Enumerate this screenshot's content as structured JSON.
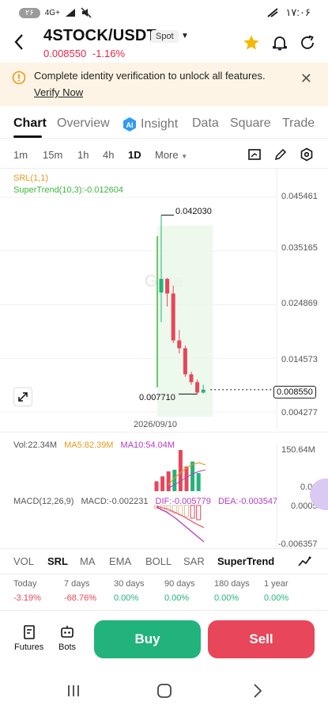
{
  "status": {
    "sim_badge": "۲۶",
    "net": "4G+",
    "time": "۱۷:۰۶"
  },
  "header": {
    "pair": "4STOCK/USDT",
    "market_type": "Spot",
    "price": "0.008550",
    "change": "-1.16%"
  },
  "banner": {
    "message": "Complete identity verification to unlock all features.",
    "link": "Verify Now"
  },
  "tabs": [
    "Chart",
    "Overview",
    "Insight",
    "Data",
    "Square",
    "Trade"
  ],
  "intervals": [
    "1m",
    "15m",
    "1h",
    "4h",
    "1D",
    "More"
  ],
  "chart": {
    "srl_label": "SRL(1,1)",
    "supertrend_label": "SuperTrend(10,3):-0.012604",
    "y_ticks": [
      "0.045461",
      "0.035165",
      "0.024869",
      "0.014573",
      "0.004277"
    ],
    "max_label": "0.042030",
    "min_label": "0.007710",
    "current_price": "0.008550",
    "date": "2026/09/10",
    "watermark": "Gate"
  },
  "chart_data": {
    "type": "candlestick",
    "title": "",
    "ylim": [
      0.004277,
      0.045461
    ],
    "y_ticks": [
      0.045461,
      0.035165,
      0.024869,
      0.014573,
      0.004277
    ],
    "candles": [
      {
        "o": 0.0272,
        "h": 0.04203,
        "l": 0.0215,
        "c": 0.0298
      },
      {
        "o": 0.0298,
        "h": 0.03,
        "l": 0.0245,
        "c": 0.027
      },
      {
        "o": 0.027,
        "h": 0.0285,
        "l": 0.0175,
        "c": 0.018
      },
      {
        "o": 0.018,
        "h": 0.02,
        "l": 0.0155,
        "c": 0.0165
      },
      {
        "o": 0.0165,
        "h": 0.017,
        "l": 0.011,
        "c": 0.0115
      },
      {
        "o": 0.0115,
        "h": 0.012,
        "l": 0.0095,
        "c": 0.01
      },
      {
        "o": 0.01,
        "h": 0.0105,
        "l": 0.00771,
        "c": 0.008
      },
      {
        "o": 0.008,
        "h": 0.0095,
        "l": 0.0078,
        "c": 0.00855
      }
    ],
    "current": 0.00855,
    "high_label": 0.04203,
    "low_label": 0.00771,
    "volume": [
      12,
      18,
      24,
      26,
      50,
      30,
      36,
      22
    ],
    "volume_up": [
      false,
      false,
      false,
      true,
      false,
      false,
      true,
      true
    ]
  },
  "volume": {
    "vol": "Vol:22.34M",
    "ma5": "MA5:82.39M",
    "ma10": "MA10:54.04M",
    "y_top": "150.64M",
    "y_zero": "0.00"
  },
  "macd": {
    "label": "MACD(12,26,9)",
    "macd": "MACD:-0.002231",
    "dif": "DIF:-0.005779",
    "dea": "DEA:-0.003547",
    "y_mid": "0.000577",
    "y_bottom": "-0.006357"
  },
  "indicators": [
    "VOL",
    "SRL",
    "MA",
    "EMA",
    "BOLL",
    "SAR",
    "SuperTrend"
  ],
  "performance": [
    {
      "label": "Today",
      "value": "-3.19%"
    },
    {
      "label": "7 days",
      "value": "-68.76%"
    },
    {
      "label": "30 days",
      "value": "0.00%"
    },
    {
      "label": "90 days",
      "value": "0.00%"
    },
    {
      "label": "180 days",
      "value": "0.00%"
    },
    {
      "label": "1 year",
      "value": "0.00%"
    }
  ],
  "bottom": {
    "futures": "Futures",
    "bots": "Bots",
    "buy": "Buy",
    "sell": "Sell"
  },
  "colors": {
    "up": "#21b37b",
    "down": "#e8465b",
    "accent_star": "#f5b800",
    "supertrend": "#3db53d",
    "srl": "#e39a1d"
  }
}
